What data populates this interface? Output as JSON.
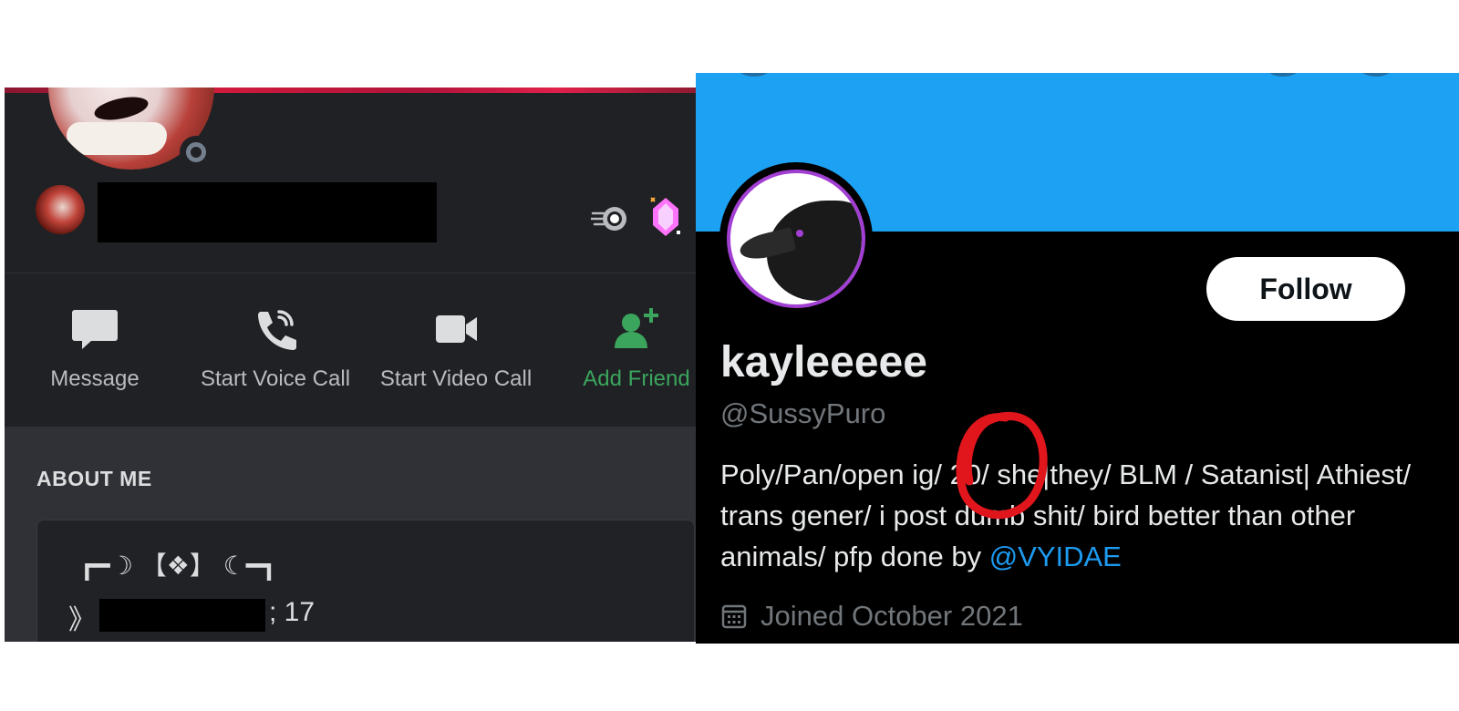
{
  "discord": {
    "actions": [
      {
        "label": "Message",
        "icon": "message-icon"
      },
      {
        "label": "Start Voice Call",
        "icon": "phone-icon"
      },
      {
        "label": "Start Video Call",
        "icon": "video-camera-icon"
      },
      {
        "label": "Add Friend",
        "icon": "add-friend-icon"
      }
    ],
    "about_title": "ABOUT ME",
    "about_line1": "┏━☽ 【❖】 ☾━┓",
    "about_line2_prefix": "》",
    "about_age": "; 17",
    "colors": {
      "background": "#1f2124",
      "about_bg": "#2f3136",
      "text": "#b9bbbe",
      "add_friend": "#3ba55d"
    }
  },
  "twitter": {
    "follow_label": "Follow",
    "name": "kayleeeee",
    "handle": "@SussyPuro",
    "bio_text": "Poly/Pan/open ig/ 20/ she|they/ BLM / Satanist| Athiest/ trans gener/ i post dumb shit/ bird better than other animals/ pfp done by ",
    "bio_mention": "@VYIDAE",
    "joined": "Joined October 2021",
    "colors": {
      "header": "#1da1f2",
      "background": "#000000",
      "mention": "#1d9bf0",
      "annotation": "#e0161c"
    }
  }
}
